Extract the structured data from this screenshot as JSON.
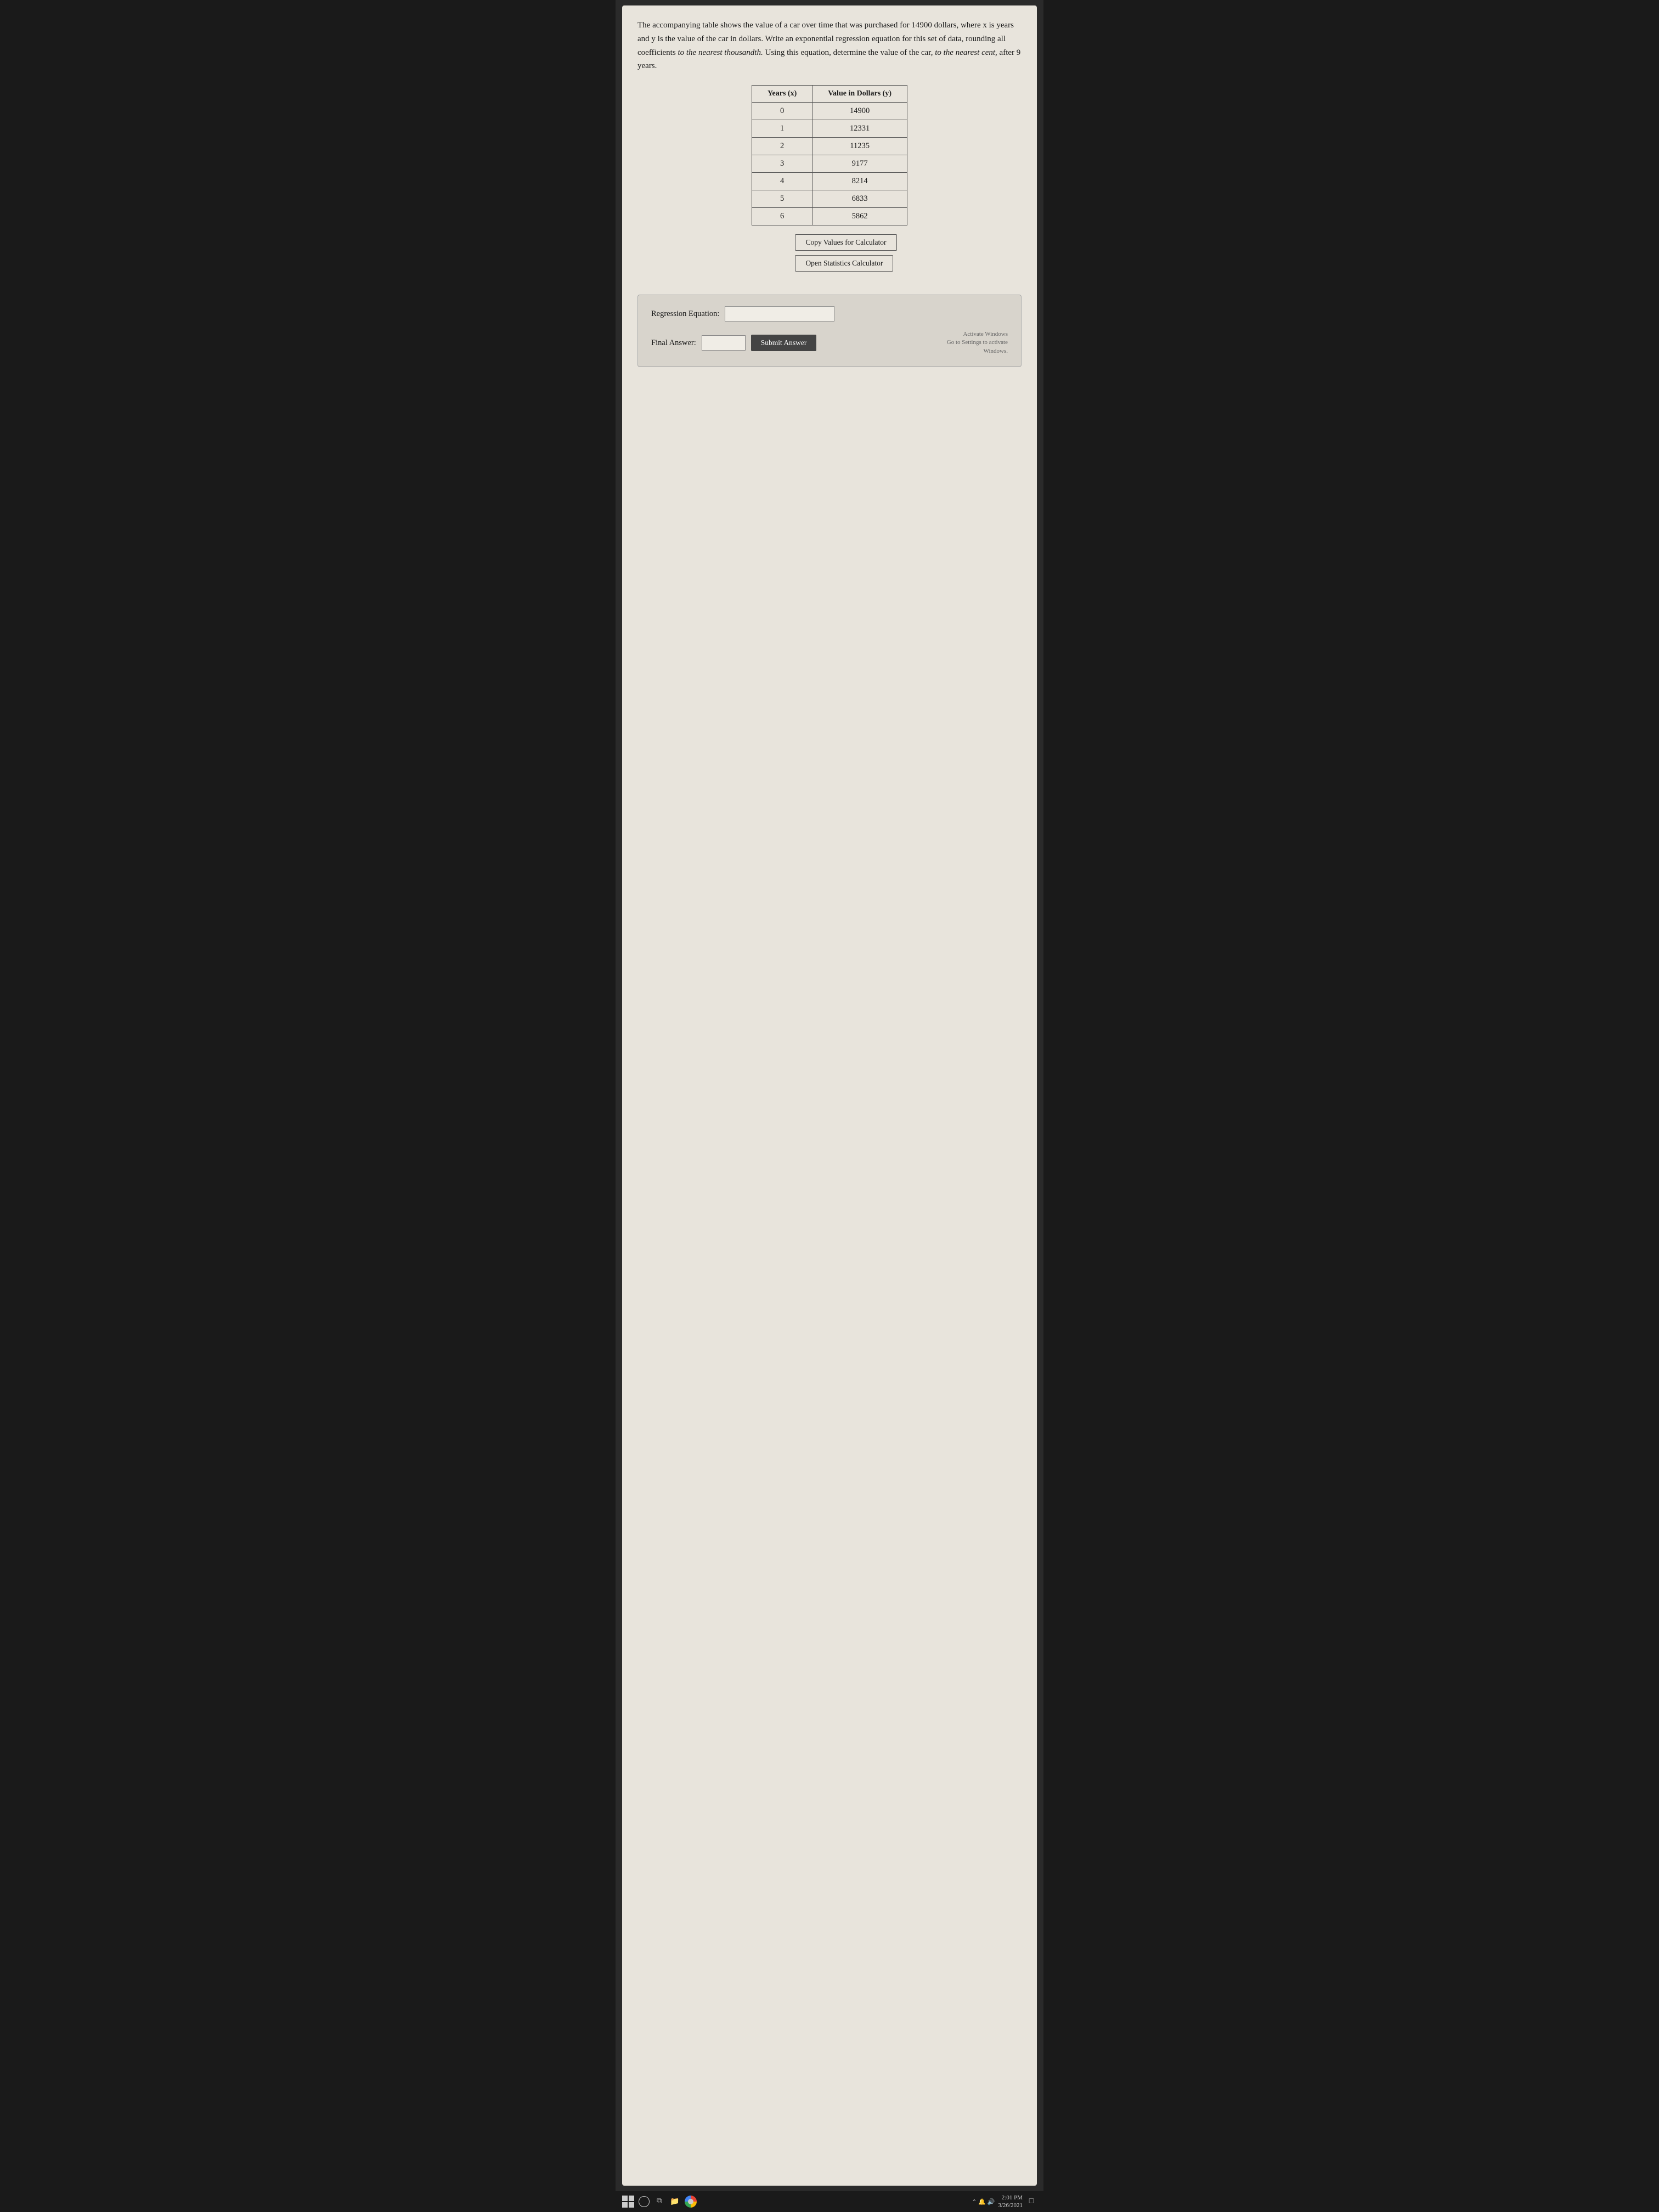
{
  "problem": {
    "text_part1": "The accompanying table shows the value of a car over time that was purchased for 14900 dollars, where x is years and y is the value of the car in dollars. Write an exponential regression equation for this set of data, rounding all coefficients ",
    "italic1": "to the nearest thousandth.",
    "text_part2": " Using this equation, determine the value of the car, ",
    "italic2": "to the nearest cent,",
    "text_part3": " after 9 years."
  },
  "table": {
    "col1_header": "Years (x)",
    "col2_header": "Value in Dollars (y)",
    "rows": [
      {
        "x": "0",
        "y": "14900"
      },
      {
        "x": "1",
        "y": "12331"
      },
      {
        "x": "2",
        "y": "11235"
      },
      {
        "x": "3",
        "y": "9177"
      },
      {
        "x": "4",
        "y": "8214"
      },
      {
        "x": "5",
        "y": "6833"
      },
      {
        "x": "6",
        "y": "5862"
      }
    ]
  },
  "buttons": {
    "copy_values": "Copy Values for Calculator",
    "open_calculator": "Open Statistics Calculator"
  },
  "answer_section": {
    "regression_label": "Regression Equation:",
    "regression_placeholder": "",
    "final_answer_label": "Final Answer:",
    "final_answer_placeholder": "",
    "submit_label": "Submit Answer",
    "activate_line1": "Activate Windows",
    "activate_line2": "Go to Settings to activate",
    "activate_line3": "Windows."
  },
  "taskbar": {
    "time": "2:01 PM",
    "date": "3/26/2021"
  }
}
